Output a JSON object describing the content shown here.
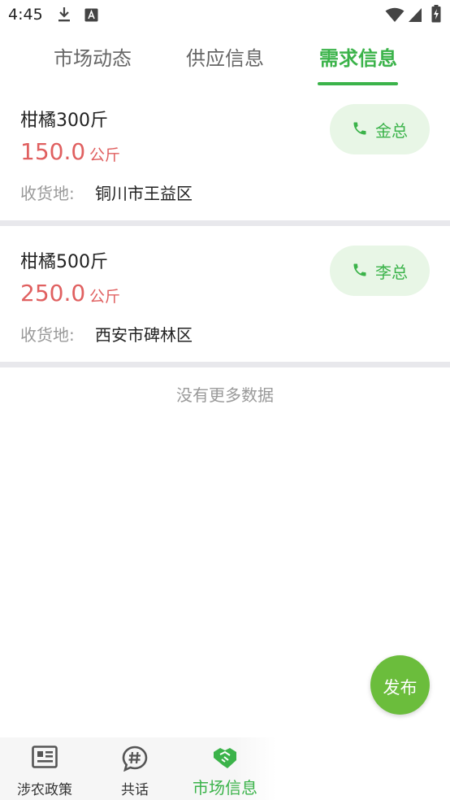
{
  "status_bar": {
    "time": "4:45",
    "icons": [
      "download-icon",
      "text-a-icon",
      "wifi-icon",
      "signal-icon",
      "battery-charging-icon"
    ]
  },
  "tabs": [
    {
      "label": "市场动态",
      "active": false
    },
    {
      "label": "供应信息",
      "active": false
    },
    {
      "label": "需求信息",
      "active": true
    }
  ],
  "listings": [
    {
      "title": "柑橘300斤",
      "price": "150.0",
      "unit": "公斤",
      "location_label": "收货地:",
      "location": "铜川市王益区",
      "contact": "金总"
    },
    {
      "title": "柑橘500斤",
      "price": "250.0",
      "unit": "公斤",
      "location_label": "收货地:",
      "location": "西安市碑林区",
      "contact": "李总"
    }
  ],
  "no_more_text": "没有更多数据",
  "fab_label": "发布",
  "bottom_nav": [
    {
      "label": "涉农政策",
      "icon": "newspaper-icon",
      "active": false
    },
    {
      "label": "共话",
      "icon": "hashtag-chat-icon",
      "active": false
    },
    {
      "label": "市场信息",
      "icon": "handshake-icon",
      "active": true
    }
  ],
  "colors": {
    "accent": "#3bb34a",
    "price": "#e06060",
    "fab": "#6bbd3c",
    "contact_bg": "#e8f6e6",
    "divider": "#e8e8ec"
  }
}
